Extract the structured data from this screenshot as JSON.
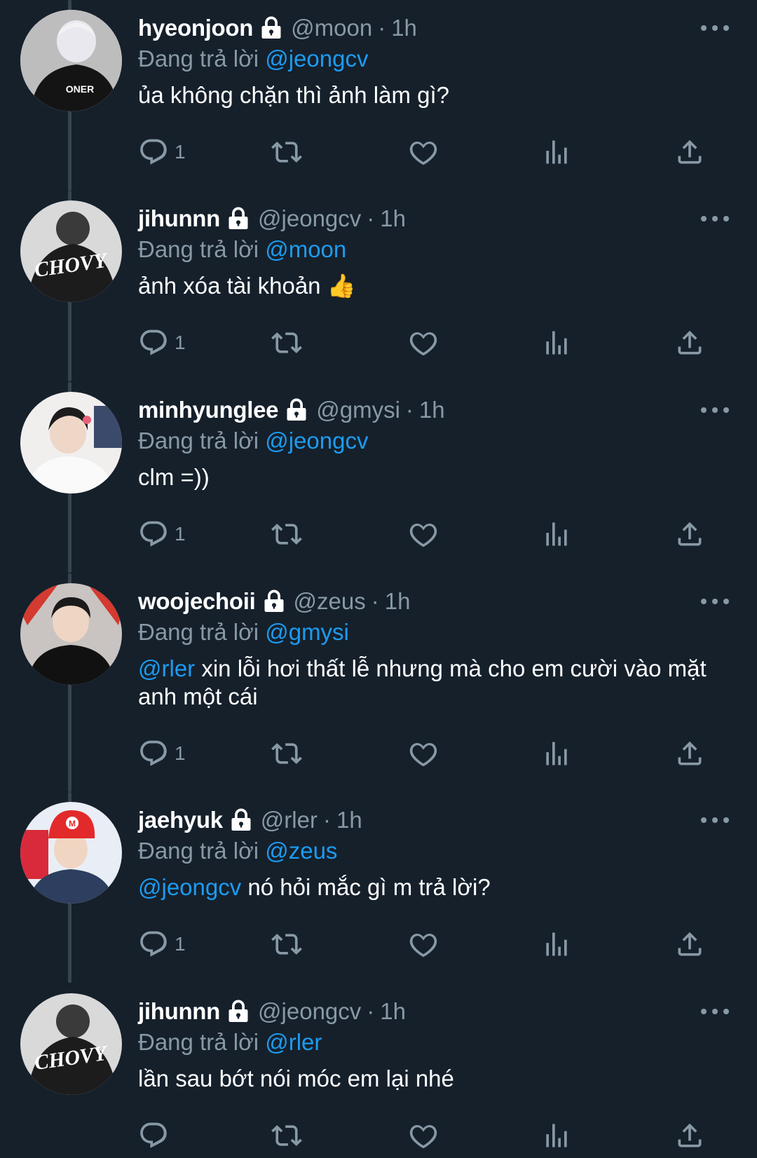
{
  "replying_prefix": "Đang trả lời",
  "tweets": [
    {
      "name": "hyeonjoon",
      "handle": "@moon",
      "separator": "·",
      "time": "1h",
      "reply_to": "@jeongcv",
      "body_mention": "",
      "body_text": "ủa không chặn thì ảnh làm gì?",
      "reply_count": "1",
      "avatar_text": "ONER"
    },
    {
      "name": "jihunnn",
      "handle": "@jeongcv",
      "separator": "·",
      "time": "1h",
      "reply_to": "@moon",
      "body_mention": "",
      "body_text": "ảnh xóa tài khoản 👍",
      "reply_count": "1",
      "avatar_text": "CHOVY"
    },
    {
      "name": "minhyunglee",
      "handle": "@gmysi",
      "separator": "·",
      "time": "1h",
      "reply_to": "@jeongcv",
      "body_mention": "",
      "body_text": "clm =))",
      "reply_count": "1",
      "avatar_text": ""
    },
    {
      "name": "woojechoii",
      "handle": "@zeus",
      "separator": "·",
      "time": "1h",
      "reply_to": "@gmysi",
      "body_mention": "@rler",
      "body_text": " xin lỗi hơi thất lễ nhưng mà cho em cười vào mặt anh một cái",
      "reply_count": "1",
      "avatar_text": ""
    },
    {
      "name": "jaehyuk",
      "handle": "@rler",
      "separator": "·",
      "time": "1h",
      "reply_to": "@zeus",
      "body_mention": "@jeongcv",
      "body_text": " nó hỏi mắc gì m trả lời?",
      "reply_count": "1",
      "avatar_text": ""
    },
    {
      "name": "jihunnn",
      "handle": "@jeongcv",
      "separator": "·",
      "time": "1h",
      "reply_to": "@rler",
      "body_mention": "",
      "body_text": "lần sau bớt nói móc em lại nhé",
      "reply_count": "",
      "avatar_text": "CHOVY"
    }
  ],
  "icons": {
    "lock": "lock-icon",
    "more": "more-icon",
    "reply": "reply-icon",
    "retweet": "retweet-icon",
    "like": "like-icon",
    "views": "views-icon",
    "share": "share-icon"
  },
  "colors": {
    "background": "#15202b",
    "text": "#ffffff",
    "muted": "#8899a6",
    "mention": "#1d9bf0",
    "thread_line": "#38444d"
  }
}
